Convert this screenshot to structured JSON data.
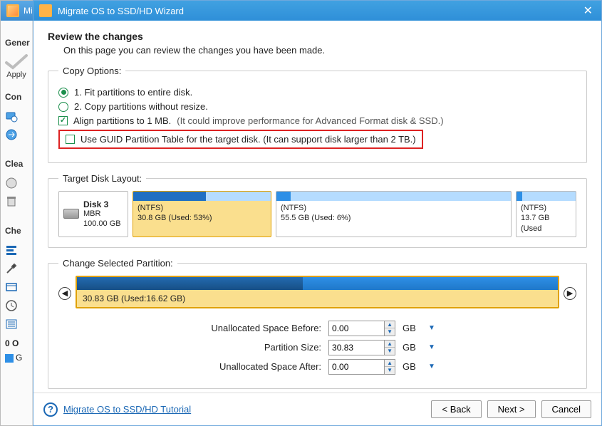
{
  "bg": {
    "title_short": "Mi",
    "tabs": {
      "general": "Gener"
    },
    "apply": "Apply",
    "sections": {
      "common": "Con",
      "clean": "Clea",
      "check": "Che"
    },
    "ops_label": "0 O",
    "g_item": "G"
  },
  "wizard": {
    "title": "Migrate OS to SSD/HD Wizard",
    "heading": "Review the changes",
    "subheading": "On this page you can review the changes you have been made."
  },
  "copy_options": {
    "legend": "Copy Options:",
    "opt1": "1. Fit partitions to entire disk.",
    "opt2": "2. Copy partitions without resize.",
    "align": "Align partitions to 1 MB.",
    "align_hint": "(It could improve performance for Advanced Format disk & SSD.)",
    "guid": "Use GUID Partition Table for the target disk. (It can support disk larger than 2 TB.)",
    "selected_mode": 1,
    "align_checked": true,
    "guid_checked": false
  },
  "target_layout": {
    "legend": "Target Disk Layout:",
    "disk": {
      "name": "Disk 3",
      "type": "MBR",
      "size": "100.00 GB"
    },
    "partitions": [
      {
        "fs": "(NTFS)",
        "info": "30.8 GB (Used: 53%)",
        "selected": true,
        "unused_pct": 47
      },
      {
        "fs": "(NTFS)",
        "info": "55.5 GB (Used: 6%)",
        "selected": false,
        "unused_pct": 94
      },
      {
        "fs": "(NTFS)",
        "info": "13.7 GB (Used",
        "selected": false,
        "unused_pct": 90
      }
    ]
  },
  "change_partition": {
    "legend": "Change Selected Partition:",
    "summary": "30.83 GB (Used:16.62 GB)",
    "fields": {
      "before_label": "Unallocated Space Before:",
      "size_label": "Partition Size:",
      "after_label": "Unallocated Space After:",
      "before": "0.00",
      "size": "30.83",
      "after": "0.00",
      "unit": "GB"
    }
  },
  "footer": {
    "tutorial": "Migrate OS to SSD/HD Tutorial",
    "back": "< Back",
    "next": "Next >",
    "cancel": "Cancel"
  }
}
